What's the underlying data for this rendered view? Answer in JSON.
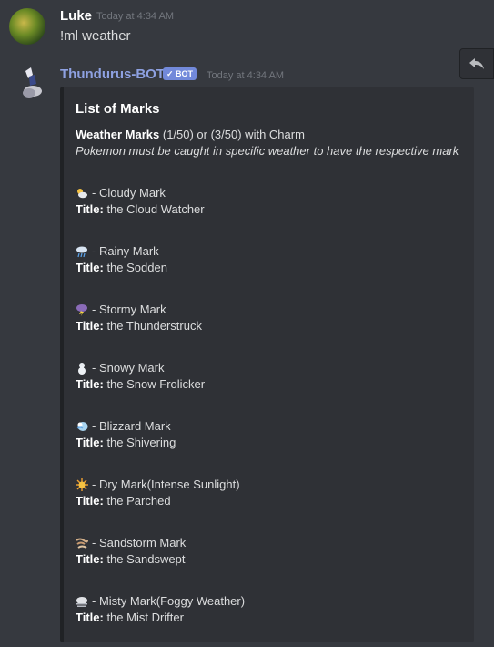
{
  "messages": [
    {
      "author": "Luke",
      "timestamp": "Today at 4:34 AM",
      "text": "!ml weather"
    },
    {
      "author": "Thundurus-BOT",
      "bot_badge": "✓ BOT",
      "timestamp": "Today at 4:34 AM"
    }
  ],
  "embed": {
    "title": "List of Marks",
    "field_bold": "Weather Marks",
    "field_rest": " (1/50) or (3/50) with Charm",
    "subtitle": "Pokemon must be caught in specific weather to have the respective mark",
    "title_label": "Title:",
    "marks": [
      {
        "icon": "cloudy-icon",
        "name": " - Cloudy Mark",
        "title": " the Cloud Watcher"
      },
      {
        "icon": "rainy-icon",
        "name": " - Rainy Mark",
        "title": " the Sodden"
      },
      {
        "icon": "stormy-icon",
        "name": " - Stormy Mark",
        "title": " the Thunderstruck"
      },
      {
        "icon": "snowy-icon",
        "name": " - Snowy Mark",
        "title": " the Snow Frolicker"
      },
      {
        "icon": "blizzard-icon",
        "name": " - Blizzard Mark",
        "title": " the Shivering"
      },
      {
        "icon": "sun-icon",
        "name": " - Dry Mark(Intense Sunlight)",
        "title": " the Parched"
      },
      {
        "icon": "sandstorm-icon",
        "name": " - Sandstorm Mark",
        "title": " the Sandswept"
      },
      {
        "icon": "fog-icon",
        "name": " - Misty Mark(Foggy Weather)",
        "title": " the Mist Drifter"
      }
    ]
  },
  "colors": {
    "background": "#36393f",
    "embed_bg": "#2f3136",
    "bot_badge": "#7289da",
    "bot_name": "#8ea1e1"
  }
}
